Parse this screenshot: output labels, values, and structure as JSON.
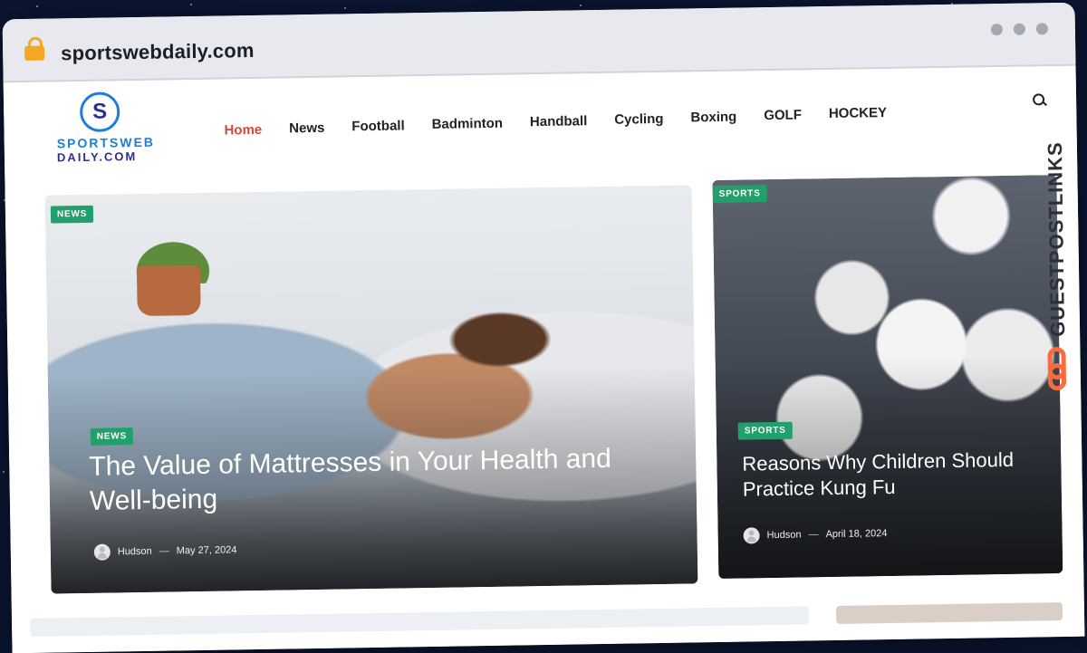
{
  "browser": {
    "url": "sportswebdaily.com",
    "icons": {
      "lock": "lock-icon",
      "window_controls": [
        "dot",
        "dot",
        "dot"
      ]
    }
  },
  "site": {
    "logo": {
      "line1": "SPORTSWEB",
      "line2": "DAILY.COM",
      "mark": "S"
    },
    "nav": [
      {
        "label": "Home",
        "active": true
      },
      {
        "label": "News"
      },
      {
        "label": "Football"
      },
      {
        "label": "Badminton"
      },
      {
        "label": "Handball"
      },
      {
        "label": "Cycling"
      },
      {
        "label": "Boxing"
      },
      {
        "label": "GOLF"
      },
      {
        "label": "HOCKEY"
      }
    ],
    "search_icon": "search-icon",
    "featured": {
      "top_badge": "NEWS",
      "badge": "NEWS",
      "title": "The Value of Mattresses in Your Health and Well-being",
      "author": "Hudson",
      "date": "May 27, 2024"
    },
    "side": {
      "top_badge": "SPORTS",
      "badge": "SPORTS",
      "title": "Reasons Why Children Should Practice Kung Fu",
      "author": "Hudson",
      "date": "April 18, 2024"
    },
    "watermark": {
      "text": "GUESTPOSTLINKS"
    }
  },
  "colors": {
    "accent_active": "#d9453b",
    "badge_green": "#22a06b",
    "watermark_orange": "#ff6a3d",
    "background_space": "#0b1530"
  }
}
